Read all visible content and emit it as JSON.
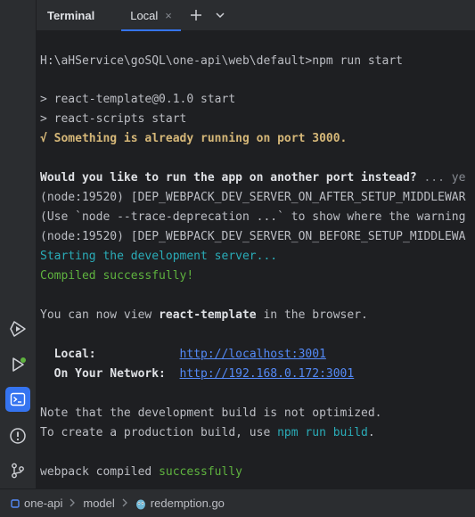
{
  "header": {
    "title": "Terminal",
    "tab_label": "Local",
    "tab_close": "×"
  },
  "terminal": {
    "prompt": "H:\\aHService\\goSQL\\one-api\\web\\default>npm run start",
    "script_line_1": "> react-template@0.1.0 start",
    "script_line_2": "> react-scripts start",
    "already_running": "√ Something is already running on port 3000.",
    "question": "Would you like to run the app on another port instead?",
    "question_tail": " ... ye",
    "deprecation_1": "(node:19520) [DEP_WEBPACK_DEV_SERVER_ON_AFTER_SETUP_MIDDLEWAR",
    "deprecation_hint": "(Use `node --trace-deprecation ...` to show where the warning",
    "deprecation_2": "(node:19520) [DEP_WEBPACK_DEV_SERVER_ON_BEFORE_SETUP_MIDDLEWA",
    "starting": "Starting the development server...",
    "compiled": "Compiled successfully!",
    "view_prefix": "You can now view ",
    "app_name": "react-template",
    "view_suffix": " in the browser.",
    "local_label": "  Local:            ",
    "local_url": "http://localhost:3001",
    "network_label": "  On Your Network:  ",
    "network_url": "http://192.168.0.172:3001",
    "note": "Note that the development build is not optimized.",
    "prod_prefix": "To create a production build, use ",
    "prod_cmd": "npm run build",
    "prod_suffix": ".",
    "webpack_prefix": "webpack compiled ",
    "webpack_status": "successfully"
  },
  "breadcrumb": {
    "items": [
      "one-api",
      "model",
      "redemption.go"
    ]
  },
  "colors": {
    "accent": "#3574f0",
    "success": "#5fb33f",
    "warning": "#d5b778",
    "info": "#2aacb8",
    "link": "#548af7"
  }
}
